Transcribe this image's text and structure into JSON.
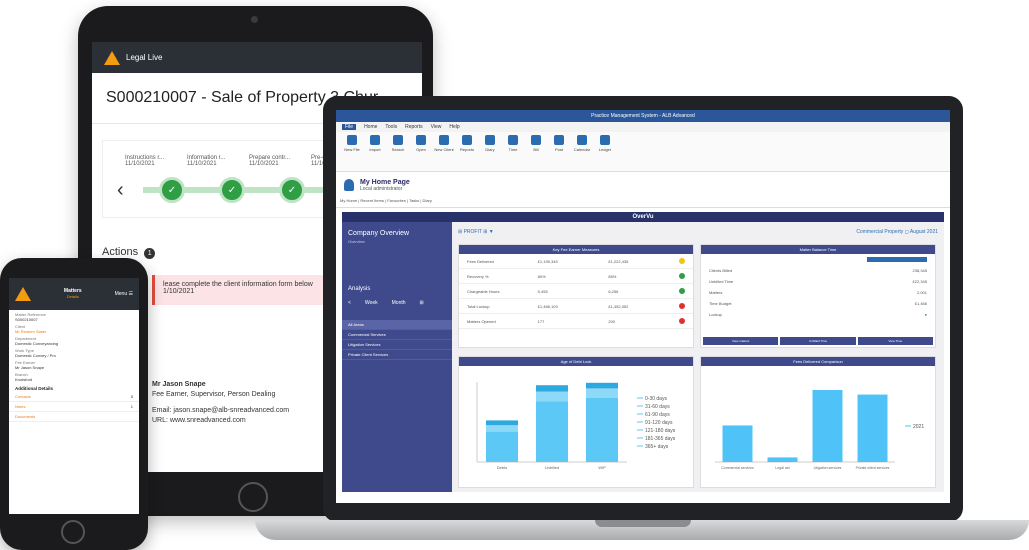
{
  "tablet": {
    "app_name": "Legal Live",
    "title": "S000210007 - Sale of Property 3 Chur",
    "steps": [
      {
        "label": "Instructions r...",
        "date": "11/10/2021"
      },
      {
        "label": "Information r...",
        "date": "11/10/2021"
      },
      {
        "label": "Prepare contr...",
        "date": "11/10/2021"
      },
      {
        "label": "Pre-exchang",
        "date": "11/10/2021"
      }
    ],
    "actions_label": "Actions",
    "actions_count": "1",
    "alert_text": "lease complete the client information form below",
    "alert_date": "1/10/2021",
    "contact_name": "Mr Jason Snape",
    "contact_role": "Fee Earner, Supervisor, Person Dealing",
    "contact_email": "Email: jason.snape@alb-snreadvanced.com",
    "contact_url": "URL: www.snreadvanced.com"
  },
  "laptop": {
    "window_title": "Practice Management System - ALB Advanced",
    "ribbon_tabs": [
      "File",
      "Home",
      "Tools",
      "Reports",
      "View",
      "Help"
    ],
    "ribbon_buttons": [
      "New File",
      "Import",
      "Search",
      "Open",
      "New Client",
      "Reports",
      "Diary",
      "Time",
      "Bill",
      "Post",
      "Calendar",
      "Ledger"
    ],
    "home_page_title": "My Home Page",
    "home_page_sub": "Local administrator",
    "navline": "My Home | Recent Items | Favourites | Tasks | Diary",
    "overvu_title": "OverVu",
    "sidebar": {
      "heading": "Company Overview",
      "sub": "Overview",
      "analysis": "Analysis",
      "nav": [
        "<",
        "Week",
        "Month",
        "⊞"
      ],
      "items": [
        "All Areas",
        "Commercial Services",
        "Litigation Services",
        "Private Client Services"
      ]
    },
    "toolbar": {
      "left": "⊞ PROFIT ⊞ ▼",
      "right": "Commercial Property   ◻ August 2021"
    },
    "panel1": {
      "title": "Key Fee Earner Measures",
      "rows": [
        {
          "label": "Fees Delivered",
          "a": "£1,195,345",
          "b": "£1,222,435",
          "status": "#f1c40f"
        },
        {
          "label": "Recovery %",
          "a": "80%",
          "b": "85%",
          "status": "#2f9e44"
        },
        {
          "label": "Chargeable Hours",
          "a": "5,455",
          "b": "6,256",
          "status": "#2f9e44"
        },
        {
          "label": "Total Lockup",
          "a": "£1,468,103",
          "b": "£1,452,052",
          "status": "#e03131"
        },
        {
          "label": "Matters Opened",
          "a": "177",
          "b": "200",
          "status": "#e03131"
        }
      ]
    },
    "panel2": {
      "title": "Matter Balance Time",
      "rows": [
        {
          "label": "Clients Billed",
          "value": "238,345"
        },
        {
          "label": "Unbilled Time",
          "value": "£22,345"
        },
        {
          "label": "Matters",
          "value": "2,001"
        },
        {
          "label": "Time Budget",
          "value": "£1,466"
        },
        {
          "label": "Lockup",
          "value": "●"
        }
      ],
      "buttons": [
        "View matters",
        "Unbilled Time",
        "View Time"
      ]
    },
    "panel3": {
      "title": "Age of Debt Lock",
      "categories": [
        "Debts",
        "Unbilled",
        "WIP"
      ],
      "legend": [
        "0-30 days",
        "31-60 days",
        "61-90 days",
        "91-120 days",
        "121-180 days",
        "181-365 days",
        "365+ days"
      ]
    },
    "panel4": {
      "title": "Fees Delivered Comparison",
      "categories": [
        "Commercial services",
        "Legal aid",
        "Litigation services",
        "Private client services"
      ],
      "legend": [
        "2021"
      ]
    }
  },
  "phone": {
    "header_title": "Matters",
    "header_sub": "Details",
    "menu_label": "Menu",
    "fields": [
      {
        "label": "Matter Reference",
        "value": "S000210007"
      },
      {
        "label": "Client",
        "value": "Mr Reuben Slater",
        "orange": true
      },
      {
        "label": "Department",
        "value": "Domestic Conveyancing"
      },
      {
        "label": "Work Type",
        "value": "Domestic Convey / Pro"
      },
      {
        "label": "Fee Earner",
        "value": "Mr Jason Snape"
      },
      {
        "label": "Branch",
        "value": "Knutsford"
      }
    ],
    "additional_details": "Additional Details",
    "links": [
      {
        "label": "Contacts",
        "count": "5"
      },
      {
        "label": "Notes",
        "count": "1"
      },
      {
        "label": "Documents",
        "count": ""
      }
    ]
  },
  "chart_data": [
    {
      "type": "bar",
      "title": "Age of Debt Lock",
      "categories": [
        "Debts",
        "Unbilled",
        "WIP"
      ],
      "series": [
        {
          "name": "0-30 days",
          "values": [
            380,
            760,
            800
          ]
        },
        {
          "name": "31-60 days",
          "values": [
            80,
            120,
            120
          ]
        },
        {
          "name": "61-90 days",
          "values": [
            60,
            80,
            70
          ]
        }
      ]
    },
    {
      "type": "bar",
      "title": "Fees Delivered Comparison",
      "categories": [
        "Commercial services",
        "Legal aid",
        "Litigation services",
        "Private client services"
      ],
      "series": [
        {
          "name": "2021",
          "values": [
            320,
            40,
            630,
            590
          ]
        }
      ]
    }
  ]
}
